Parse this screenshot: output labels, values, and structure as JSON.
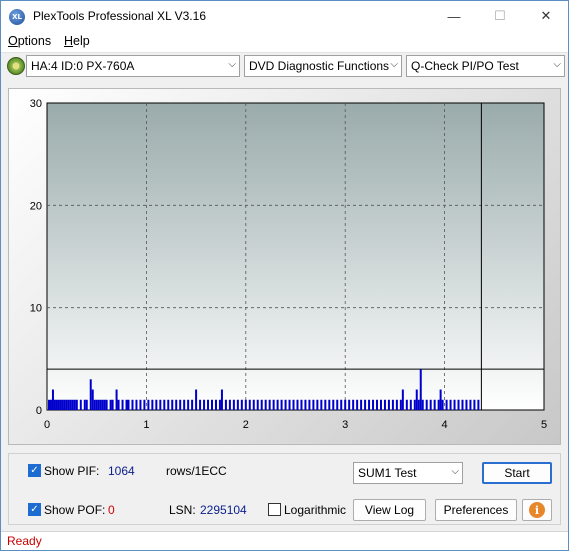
{
  "window": {
    "title": "PlexTools Professional XL V3.16",
    "icon_text": "XL"
  },
  "titlebar_buttons": {
    "minimize": "—",
    "maximize": "☐",
    "close": "✕"
  },
  "menu": [
    {
      "label": "Options",
      "accel": "O",
      "rest": "ptions"
    },
    {
      "label": "Help",
      "accel": "H",
      "rest": "elp"
    }
  ],
  "toolbar": {
    "drive": "HA:4 ID:0  PX-760A",
    "function": "DVD Diagnostic Functions",
    "test": "Q-Check PI/PO Test",
    "chevron": "⌵"
  },
  "chart_data": {
    "type": "bar",
    "title": "",
    "xlabel": "",
    "ylabel": "",
    "xlim": [
      0,
      5
    ],
    "ylim": [
      0,
      30
    ],
    "x_ticks": [
      "0",
      "1",
      "2",
      "3",
      "4",
      "5"
    ],
    "y_ticks": [
      "0",
      "10",
      "20",
      "30"
    ],
    "grid": true,
    "threshold_line": 4,
    "end_marker_x": 4.37,
    "series": [
      {
        "color": "#0000cc",
        "points": [
          [
            0.02,
            1
          ],
          [
            0.04,
            1
          ],
          [
            0.06,
            2
          ],
          [
            0.08,
            1
          ],
          [
            0.1,
            1
          ],
          [
            0.12,
            1
          ],
          [
            0.14,
            1
          ],
          [
            0.16,
            1
          ],
          [
            0.18,
            1
          ],
          [
            0.2,
            1
          ],
          [
            0.22,
            1
          ],
          [
            0.24,
            1
          ],
          [
            0.26,
            1
          ],
          [
            0.28,
            1
          ],
          [
            0.3,
            1
          ],
          [
            0.34,
            1
          ],
          [
            0.38,
            1
          ],
          [
            0.4,
            1
          ],
          [
            0.44,
            3
          ],
          [
            0.46,
            2
          ],
          [
            0.48,
            1
          ],
          [
            0.5,
            1
          ],
          [
            0.52,
            1
          ],
          [
            0.54,
            1
          ],
          [
            0.56,
            1
          ],
          [
            0.58,
            1
          ],
          [
            0.6,
            1
          ],
          [
            0.64,
            1
          ],
          [
            0.66,
            1
          ],
          [
            0.7,
            2
          ],
          [
            0.72,
            1
          ],
          [
            0.76,
            1
          ],
          [
            0.8,
            1
          ],
          [
            0.82,
            1
          ],
          [
            0.86,
            1
          ],
          [
            0.9,
            1
          ],
          [
            0.94,
            1
          ],
          [
            0.98,
            1
          ],
          [
            1.02,
            1
          ],
          [
            1.06,
            1
          ],
          [
            1.1,
            1
          ],
          [
            1.14,
            1
          ],
          [
            1.18,
            1
          ],
          [
            1.22,
            1
          ],
          [
            1.26,
            1
          ],
          [
            1.3,
            1
          ],
          [
            1.34,
            1
          ],
          [
            1.38,
            1
          ],
          [
            1.42,
            1
          ],
          [
            1.46,
            1
          ],
          [
            1.5,
            2
          ],
          [
            1.54,
            1
          ],
          [
            1.58,
            1
          ],
          [
            1.62,
            1
          ],
          [
            1.66,
            1
          ],
          [
            1.7,
            1
          ],
          [
            1.74,
            1
          ],
          [
            1.76,
            2
          ],
          [
            1.8,
            1
          ],
          [
            1.84,
            1
          ],
          [
            1.88,
            1
          ],
          [
            1.92,
            1
          ],
          [
            1.96,
            1
          ],
          [
            2.0,
            1
          ],
          [
            2.04,
            1
          ],
          [
            2.08,
            1
          ],
          [
            2.12,
            1
          ],
          [
            2.16,
            1
          ],
          [
            2.2,
            1
          ],
          [
            2.24,
            1
          ],
          [
            2.28,
            1
          ],
          [
            2.32,
            1
          ],
          [
            2.36,
            1
          ],
          [
            2.4,
            1
          ],
          [
            2.44,
            1
          ],
          [
            2.48,
            1
          ],
          [
            2.52,
            1
          ],
          [
            2.56,
            1
          ],
          [
            2.6,
            1
          ],
          [
            2.64,
            1
          ],
          [
            2.68,
            1
          ],
          [
            2.72,
            1
          ],
          [
            2.76,
            1
          ],
          [
            2.8,
            1
          ],
          [
            2.84,
            1
          ],
          [
            2.88,
            1
          ],
          [
            2.92,
            1
          ],
          [
            2.96,
            1
          ],
          [
            3.0,
            1
          ],
          [
            3.04,
            1
          ],
          [
            3.08,
            1
          ],
          [
            3.12,
            1
          ],
          [
            3.16,
            1
          ],
          [
            3.2,
            1
          ],
          [
            3.24,
            1
          ],
          [
            3.28,
            1
          ],
          [
            3.32,
            1
          ],
          [
            3.36,
            1
          ],
          [
            3.4,
            1
          ],
          [
            3.44,
            1
          ],
          [
            3.48,
            1
          ],
          [
            3.52,
            1
          ],
          [
            3.56,
            1
          ],
          [
            3.58,
            2
          ],
          [
            3.62,
            1
          ],
          [
            3.66,
            1
          ],
          [
            3.7,
            1
          ],
          [
            3.72,
            2
          ],
          [
            3.74,
            1
          ],
          [
            3.76,
            4
          ],
          [
            3.78,
            1
          ],
          [
            3.82,
            1
          ],
          [
            3.86,
            1
          ],
          [
            3.9,
            1
          ],
          [
            3.94,
            1
          ],
          [
            3.96,
            2
          ],
          [
            3.98,
            1
          ],
          [
            4.02,
            1
          ],
          [
            4.06,
            1
          ],
          [
            4.1,
            1
          ],
          [
            4.14,
            1
          ],
          [
            4.18,
            1
          ],
          [
            4.22,
            1
          ],
          [
            4.26,
            1
          ],
          [
            4.3,
            1
          ],
          [
            4.34,
            1
          ]
        ]
      }
    ]
  },
  "controls": {
    "show_pif_label": "Show PIF:",
    "pif_value": "1064",
    "rows_label": "rows/1ECC",
    "show_pof_label": "Show POF:",
    "pof_value": "0",
    "lsn_label": "LSN:",
    "lsn_value": "2295104",
    "logarithmic_label": "Logarithmic",
    "sum_select": "SUM1 Test",
    "start_button": "Start",
    "view_log_button": "View Log",
    "preferences_button": "Preferences",
    "info_glyph": "i",
    "check_glyph": "✓"
  },
  "status": {
    "text": "Ready"
  }
}
